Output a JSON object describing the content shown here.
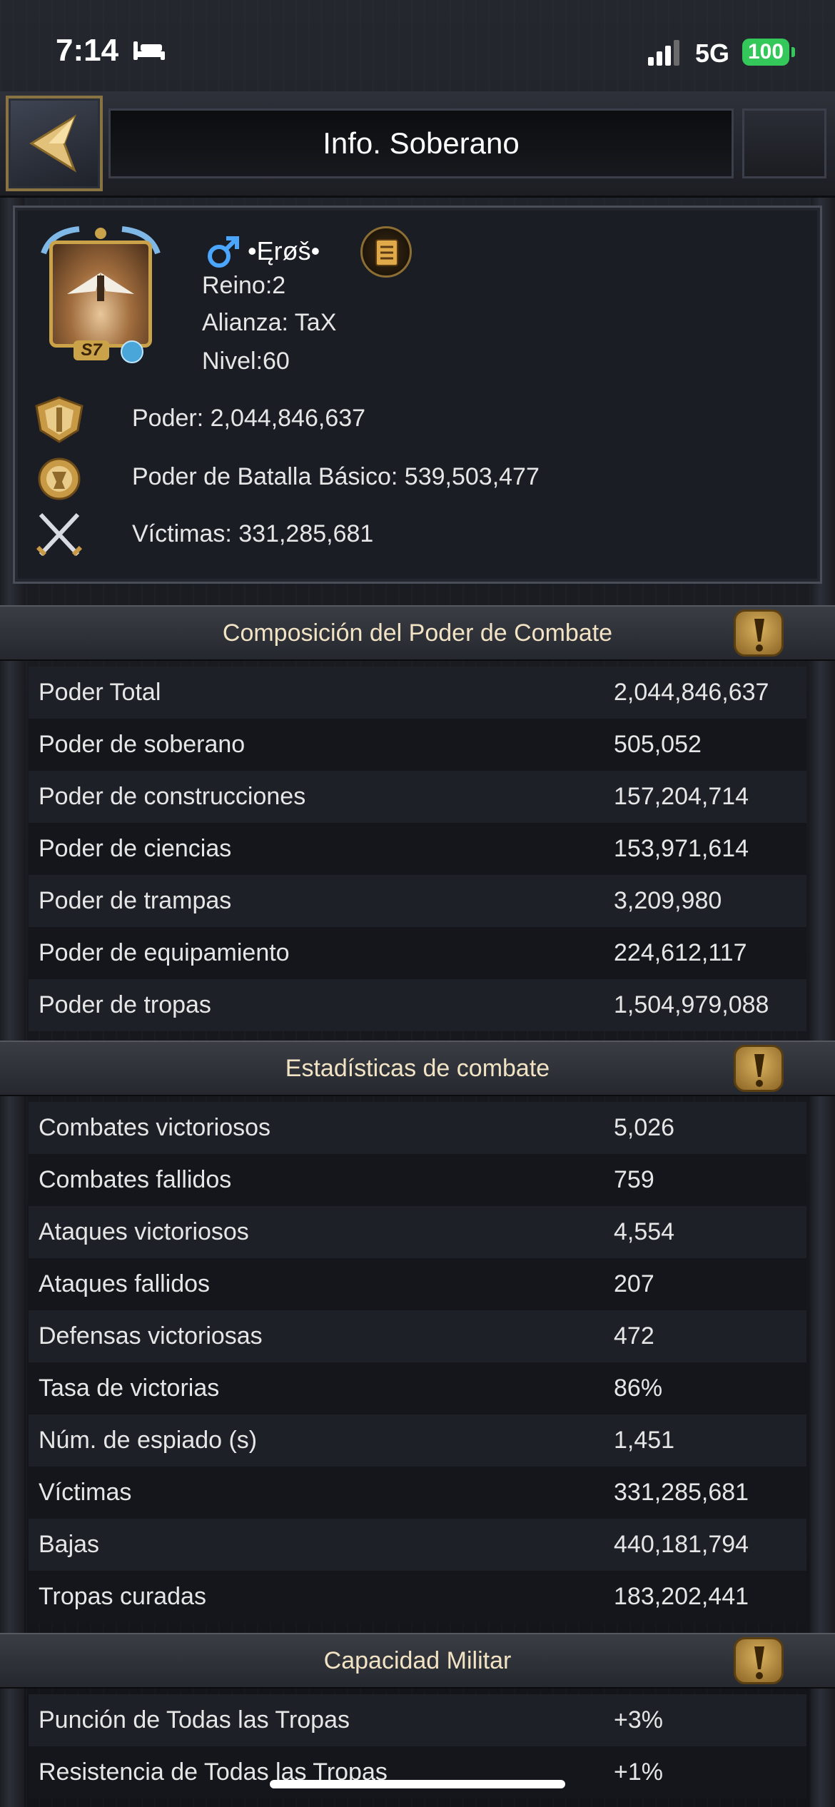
{
  "status_bar": {
    "time": "7:14",
    "network": "5G",
    "battery": "100"
  },
  "header": {
    "title": "Info. Soberano"
  },
  "profile": {
    "name": "•Ęrøš•",
    "kingdom": "Reino:2",
    "alliance": "Alianza: TaX",
    "level": "Nivel:60",
    "avatar_badge": "S7",
    "power": "Poder: 2,044,846,637",
    "battle_power": "Poder de Batalla Básico: 539,503,477",
    "kills": "Víctimas: 331,285,681"
  },
  "sections": {
    "power_composition": {
      "title": "Composición del Poder de Combate",
      "rows": [
        {
          "label": "Poder Total",
          "value": "2,044,846,637"
        },
        {
          "label": "Poder de soberano",
          "value": "505,052"
        },
        {
          "label": "Poder de construcciones",
          "value": "157,204,714"
        },
        {
          "label": "Poder de ciencias",
          "value": "153,971,614"
        },
        {
          "label": "Poder de trampas",
          "value": "3,209,980"
        },
        {
          "label": "Poder de equipamiento",
          "value": "224,612,117"
        },
        {
          "label": "Poder de tropas",
          "value": "1,504,979,088"
        }
      ]
    },
    "combat_stats": {
      "title": "Estadísticas de combate",
      "rows": [
        {
          "label": "Combates victoriosos",
          "value": "5,026"
        },
        {
          "label": "Combates fallidos",
          "value": "759"
        },
        {
          "label": "Ataques victoriosos",
          "value": "4,554"
        },
        {
          "label": "Ataques fallidos",
          "value": "207"
        },
        {
          "label": "Defensas victoriosas",
          "value": "472"
        },
        {
          "label": "Tasa de victorias",
          "value": "86%"
        },
        {
          "label": "Núm. de espiado (s)",
          "value": "1,451"
        },
        {
          "label": "Víctimas",
          "value": "331,285,681"
        },
        {
          "label": "Bajas",
          "value": "440,181,794"
        },
        {
          "label": "Tropas curadas",
          "value": "183,202,441"
        }
      ]
    },
    "military_capacity": {
      "title": "Capacidad Militar",
      "rows": [
        {
          "label": "Punción de Todas las Tropas",
          "value": "+3%"
        },
        {
          "label": "Resistencia de Todas las Tropas",
          "value": "+1%"
        }
      ]
    }
  },
  "colors": {
    "accent_gold": "#c9a24a",
    "battery_green": "#34c759",
    "section_text": "#f1e3c4"
  },
  "icons": [
    "back-arrow-icon",
    "male-icon",
    "notes-icon",
    "power-shield-icon",
    "battle-power-icon",
    "crossed-swords-icon",
    "info-icon"
  ]
}
